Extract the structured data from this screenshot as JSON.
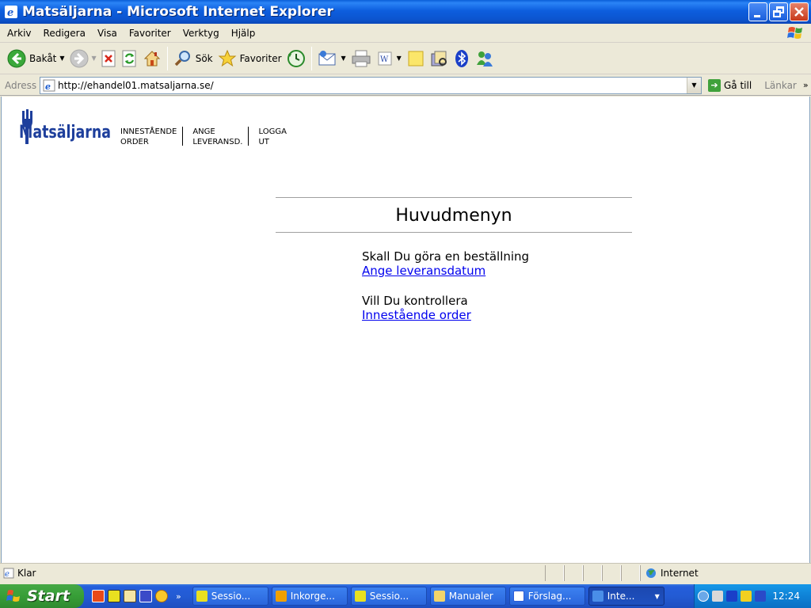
{
  "window": {
    "title": "Matsäljarna - Microsoft Internet Explorer"
  },
  "menubar": {
    "items": [
      "Arkiv",
      "Redigera",
      "Visa",
      "Favoriter",
      "Verktyg",
      "Hjälp"
    ]
  },
  "toolbar": {
    "back_label": "Bakåt",
    "search_label": "Sök",
    "favorites_label": "Favoriter"
  },
  "addressbar": {
    "label": "Adress",
    "url": "http://ehandel01.matsaljarna.se/",
    "go_label": "Gå till",
    "links_label": "Länkar"
  },
  "page": {
    "logo_text": "Matsäljarna",
    "nav": [
      {
        "label": "INNESTÅENDE\nORDER"
      },
      {
        "label": "ANGE\nLEVERANSD."
      },
      {
        "label": "LOGGA\nUT"
      }
    ],
    "heading": "Huvudmenyn",
    "groups": [
      {
        "prompt": "Skall Du göra en beställning",
        "link": "Ange leveransdatum"
      },
      {
        "prompt": "Vill Du kontrollera",
        "link": "Innestående order"
      }
    ]
  },
  "statusbar": {
    "status": "Klar",
    "zone": "Internet"
  },
  "taskbar": {
    "start_label": "Start",
    "tasks": [
      {
        "label": "Sessio...",
        "icon_color": "#e8e020"
      },
      {
        "label": "Inkorge...",
        "icon_color": "#f0a000"
      },
      {
        "label": "Sessio...",
        "icon_color": "#e8e020"
      },
      {
        "label": "Manualer",
        "icon_color": "#f2d46a"
      },
      {
        "label": "Förslag...",
        "icon_color": "#2a5bd8"
      },
      {
        "label": "Inte...",
        "icon_color": "#4a8ee8",
        "active": true
      }
    ],
    "clock": "12:24"
  },
  "colors": {
    "title_blue": "#0c55d0",
    "link_blue": "#0000ee",
    "logo_blue": "#1e3f9c",
    "taskbar_blue": "#245edb",
    "start_green": "#379e37"
  }
}
